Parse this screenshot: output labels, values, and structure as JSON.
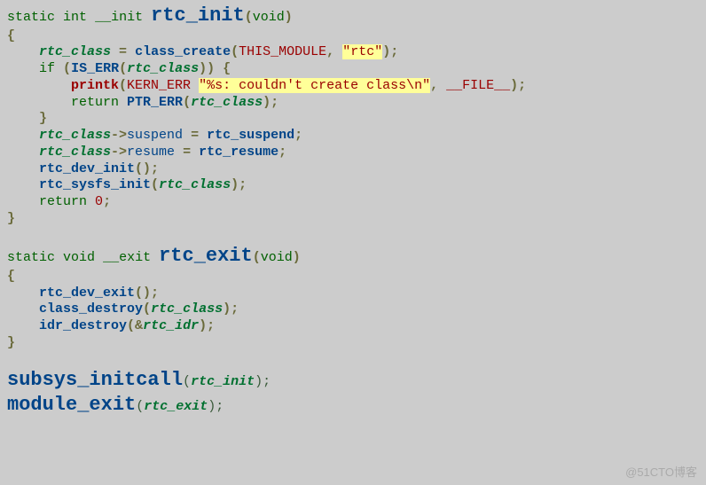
{
  "tokens": {
    "t_static": "static",
    "t_int": "int",
    "t_void": "void",
    "t__init": "__init",
    "t__exit": "__exit",
    "t_if": "if",
    "t_return": "return",
    "fn_rtc_init": "rtc_init",
    "fn_rtc_exit": "rtc_exit",
    "id_rtc_class": "rtc_class",
    "id_rtc_idr": "rtc_idr",
    "id_rtc_init": "rtc_init",
    "id_rtc_exit": "rtc_exit",
    "fn_class_create": "class_create",
    "fn_IS_ERR": "IS_ERR",
    "fn_printk": "printk",
    "fn_PTR_ERR": "PTR_ERR",
    "fn_rtc_suspend": "rtc_suspend",
    "fn_rtc_resume": "rtc_resume",
    "fn_rtc_dev_init": "rtc_dev_init",
    "fn_rtc_sysfs_init": "rtc_sysfs_init",
    "fn_rtc_dev_exit": "rtc_dev_exit",
    "fn_class_destroy": "class_destroy",
    "fn_idr_destroy": "idr_destroy",
    "fn_subsys_initcall": "subsys_initcall",
    "fn_module_exit": "module_exit",
    "macro_THIS_MODULE": "THIS_MODULE",
    "macro_KERN_ERR": "KERN_ERR",
    "macro_FILE": "__FILE__",
    "str_rtc": "\"rtc\"",
    "str_err": "\"%s: couldn't create class\\n\"",
    "m_suspend": "suspend",
    "m_resume": "resume",
    "num_zero": "0"
  },
  "watermark": "@51CTO博客"
}
